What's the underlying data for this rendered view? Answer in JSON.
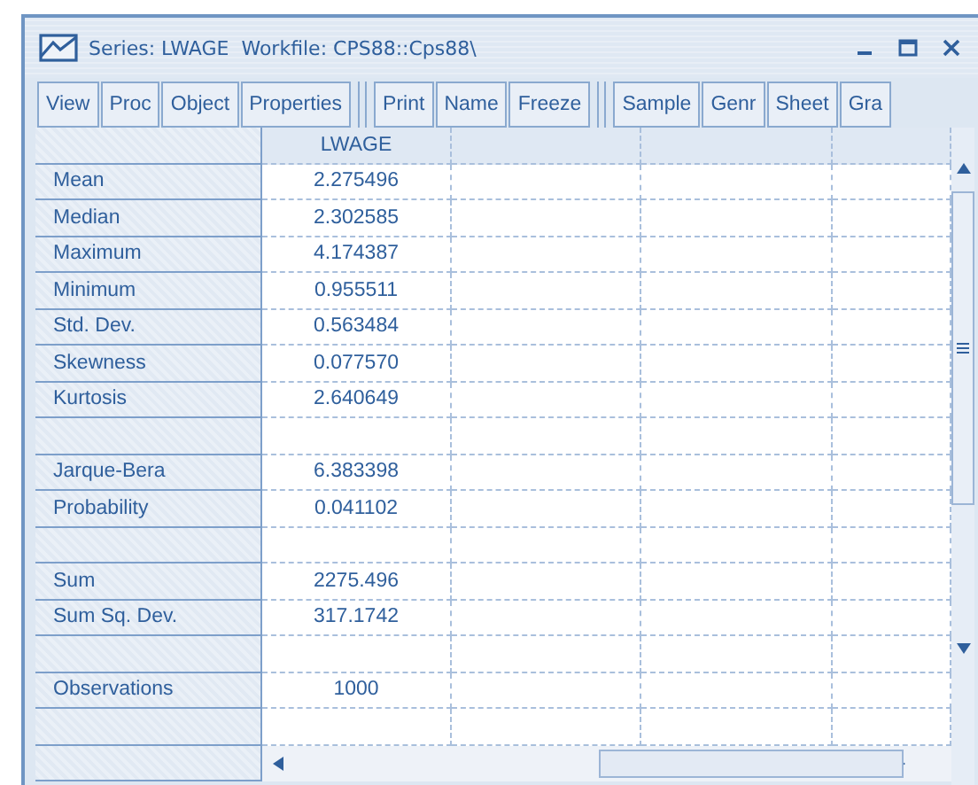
{
  "window": {
    "title": "Series: LWAGE  Workfile: CPS88::Cps88\\"
  },
  "toolbar": [
    [
      "View",
      "Proc",
      "Object",
      "Properties"
    ],
    [
      "Print",
      "Name",
      "Freeze"
    ],
    [
      "Sample",
      "Genr",
      "Sheet",
      "Gra"
    ]
  ],
  "table": {
    "columns": [
      "LWAGE"
    ],
    "rows": [
      {
        "kind": "stat",
        "label": "Mean",
        "value": "2.275496"
      },
      {
        "kind": "stat",
        "label": "Median",
        "value": "2.302585"
      },
      {
        "kind": "stat",
        "label": "Maximum",
        "value": "4.174387"
      },
      {
        "kind": "stat",
        "label": "Minimum",
        "value": "0.955511"
      },
      {
        "kind": "stat",
        "label": "Std. Dev.",
        "value": "0.563484"
      },
      {
        "kind": "stat",
        "label": "Skewness",
        "value": "0.077570"
      },
      {
        "kind": "stat",
        "label": "Kurtosis",
        "value": "2.640649"
      },
      {
        "kind": "blank"
      },
      {
        "kind": "stat",
        "label": "Jarque-Bera",
        "value": "6.383398"
      },
      {
        "kind": "stat",
        "label": "Probability",
        "value": "0.041102"
      },
      {
        "kind": "blank"
      },
      {
        "kind": "stat",
        "label": "Sum",
        "value": "2275.496"
      },
      {
        "kind": "stat",
        "label": "Sum Sq. Dev.",
        "value": "317.1742"
      },
      {
        "kind": "blank"
      },
      {
        "kind": "stat",
        "label": "Observations",
        "value": "1000"
      },
      {
        "kind": "blank"
      }
    ]
  }
}
